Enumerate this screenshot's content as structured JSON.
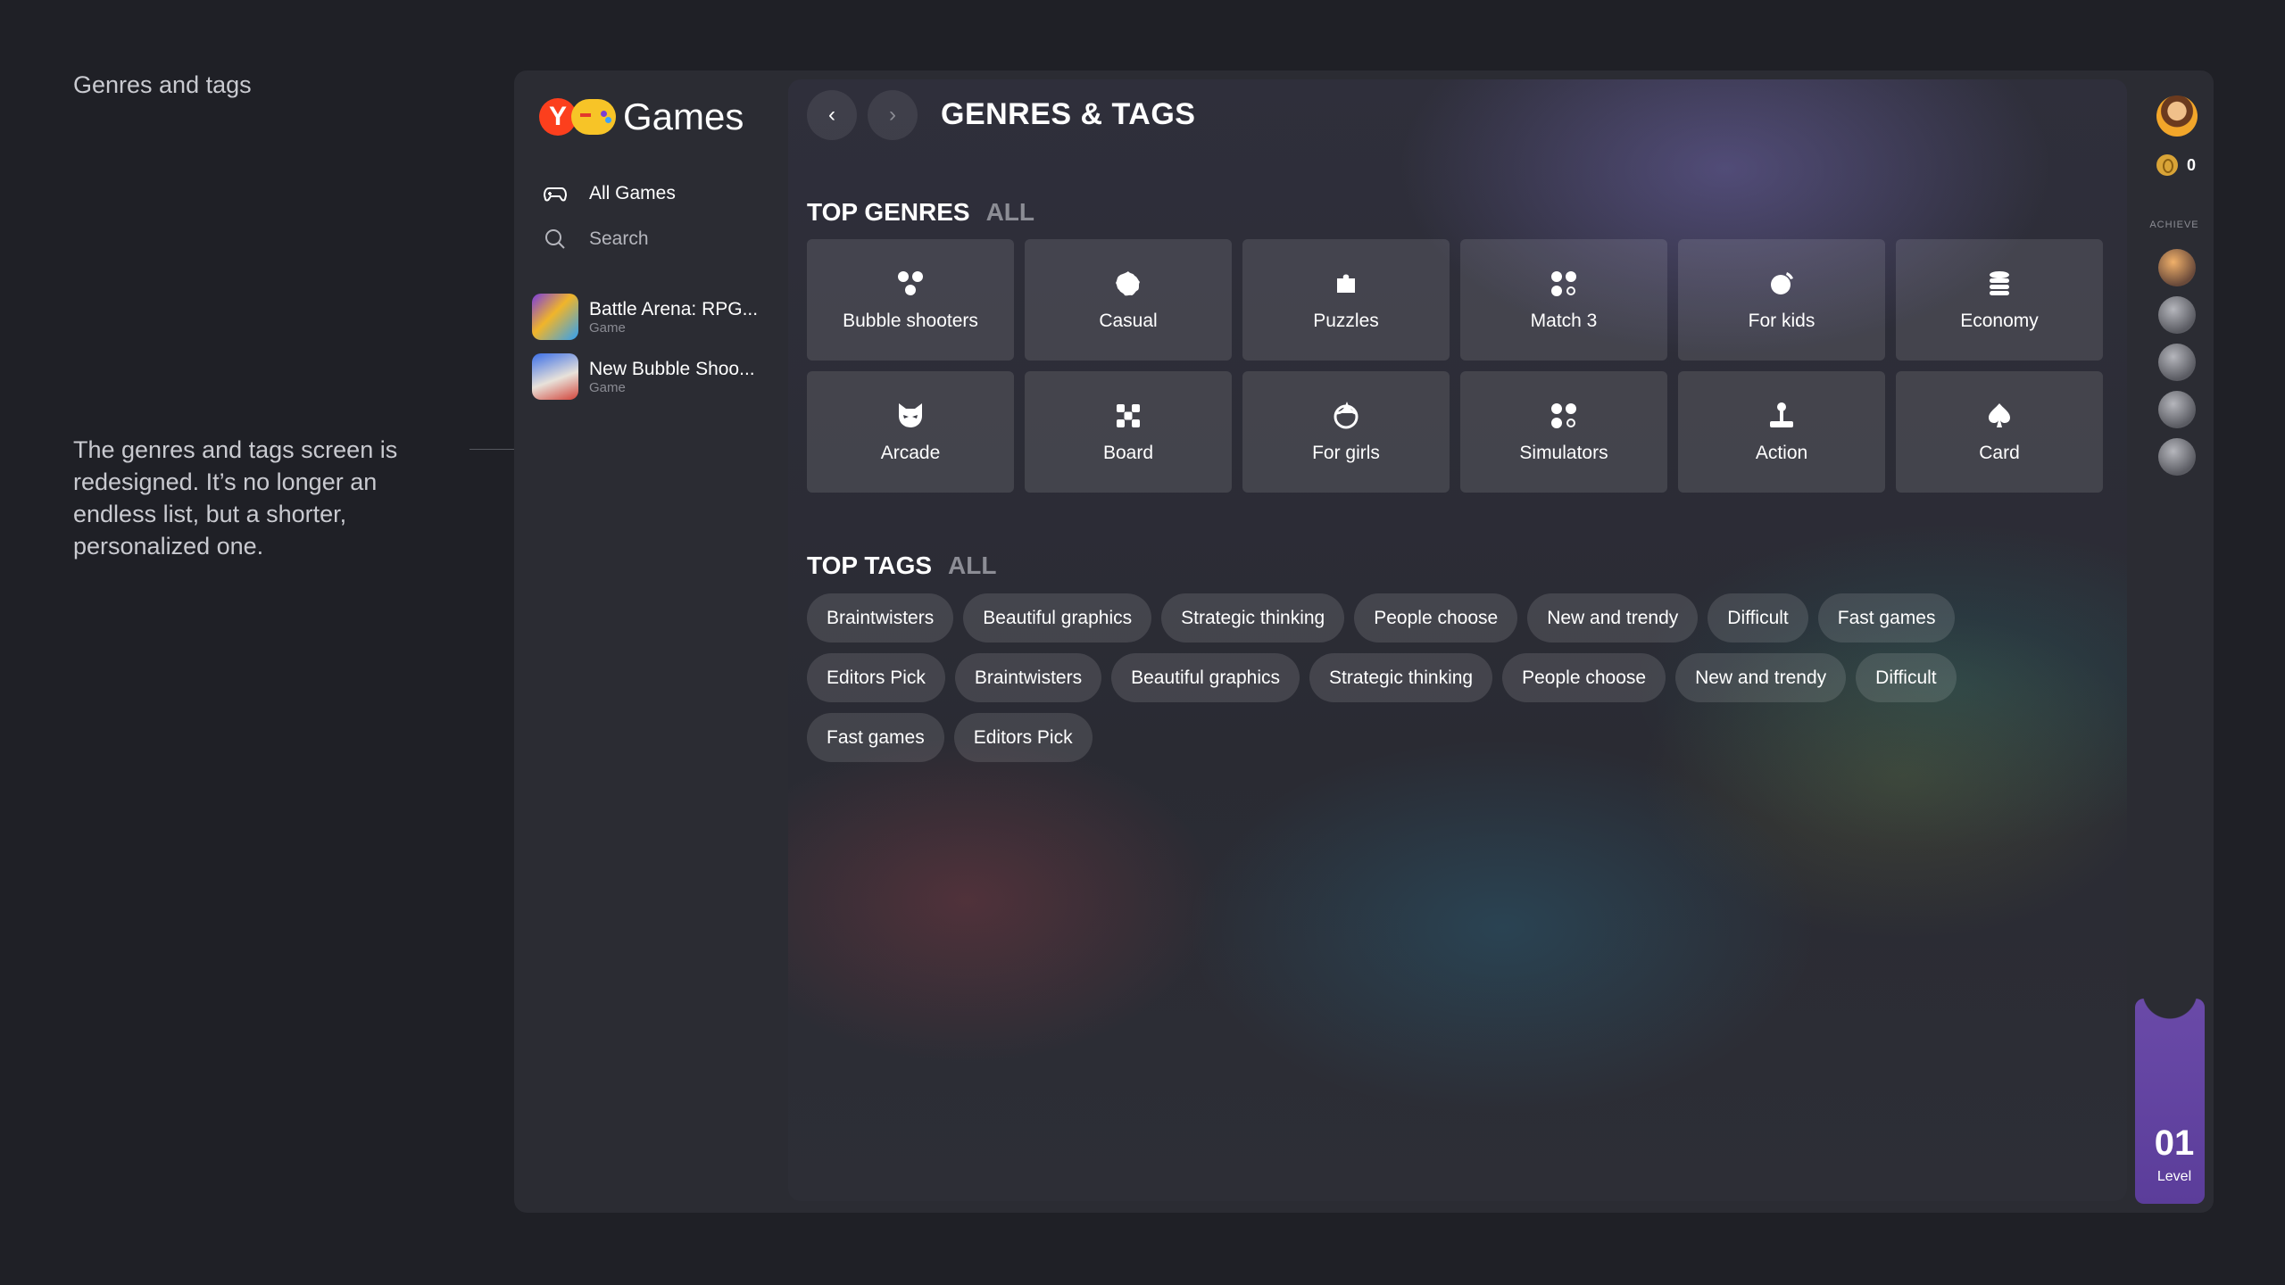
{
  "annotation": {
    "title": "Genres and tags",
    "body": "The genres and tags screen is redesigned. It’s no longer an endless list, but a shorter, personalized one."
  },
  "logo": {
    "letter": "Y",
    "text": "Games"
  },
  "nav": {
    "all_games": "All Games",
    "search": "Search"
  },
  "recent": [
    {
      "title": "Battle Arena: RPG...",
      "sub": "Game"
    },
    {
      "title": "New Bubble Shoo...",
      "sub": "Game"
    }
  ],
  "header": {
    "back": "‹",
    "forward": "›",
    "title": "GENRES & TAGS"
  },
  "genres": {
    "title": "TOP GENRES",
    "all": "ALL",
    "items": [
      {
        "label": "Bubble shooters",
        "icon": "bubbles-icon"
      },
      {
        "label": "Casual",
        "icon": "cookie-icon"
      },
      {
        "label": "Puzzles",
        "icon": "puzzle-icon"
      },
      {
        "label": "Match 3",
        "icon": "match3-icon"
      },
      {
        "label": "For kids",
        "icon": "ball-icon"
      },
      {
        "label": "Economy",
        "icon": "coins-stack-icon"
      },
      {
        "label": "Arcade",
        "icon": "cat-mask-icon"
      },
      {
        "label": "Board",
        "icon": "board-icon"
      },
      {
        "label": "For girls",
        "icon": "girl-icon"
      },
      {
        "label": "Simulators",
        "icon": "simulator-icon"
      },
      {
        "label": "Action",
        "icon": "joystick-icon"
      },
      {
        "label": "Card",
        "icon": "spade-icon"
      }
    ]
  },
  "tags": {
    "title": "TOP TAGS",
    "all": "ALL",
    "items": [
      "Braintwisters",
      "Beautiful graphics",
      "Strategic thinking",
      "People choose",
      "New and trendy",
      "Difficult",
      "Fast games",
      "Editors Pick",
      "Braintwisters",
      "Beautiful graphics",
      "Strategic thinking",
      "People choose",
      "New and trendy",
      "Difficult",
      "Fast games",
      "Editors Pick"
    ]
  },
  "rail": {
    "coins": "0",
    "achieve": "ACHIEVE",
    "level_num": "01",
    "level_label": "Level"
  },
  "colors": {
    "background": "#1f2026",
    "app": "#2b2c33",
    "accent_level": "#5b3d9a",
    "logo_red": "#fc3f1d",
    "logo_yellow": "#f7c427"
  }
}
